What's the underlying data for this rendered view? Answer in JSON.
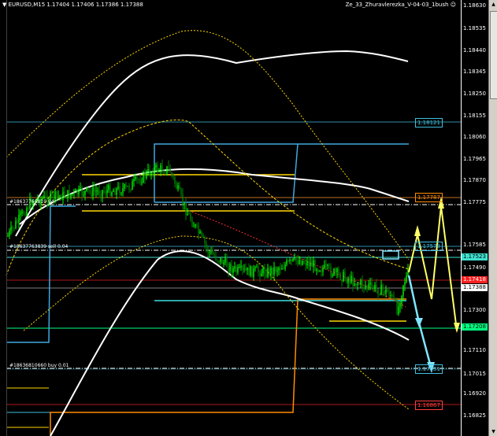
{
  "header": {
    "symbol": "▼ EURUSD,M15  1.17404 1.17406 1.17386 1.17388",
    "indicator": "Ze_33_Zhuravlerezka_V-04-03_1bush"
  },
  "colors": {
    "background": "#000000",
    "candle_up": "#00ff00",
    "candle_down": "#008000",
    "ma_fast": "#ffffff",
    "ma_slow": "#ffd700",
    "level_cyan": "#40c0e0",
    "level_orange": "#ff8c00",
    "level_red": "#ff2020",
    "arrow_yellow": "#ffff66",
    "arrow_cyan": "#7fe6ff"
  },
  "price_axis": {
    "labels": [
      "1.18630",
      "1.18535",
      "1.18440",
      "1.18345",
      "1.18250",
      "1.18155",
      "1.18060",
      "1.17965",
      "1.17870",
      "1.17775",
      "1.17585",
      "1.17490",
      "1.17300",
      "1.17110",
      "1.17015",
      "1.16920",
      "1.16825"
    ],
    "tags": [
      {
        "text": "1.17523",
        "bg": "#40e0d0",
        "fg": "#000000"
      },
      {
        "text": "1.17418",
        "bg": "#ff2020",
        "fg": "#ffffff"
      },
      {
        "text": "1.17388",
        "bg": "#ffffff",
        "fg": "#000000"
      },
      {
        "text": "1.17208",
        "bg": "#00ff80",
        "fg": "#000000"
      }
    ]
  },
  "level_tags": [
    {
      "text": "1.18121",
      "color": "#40c0e0"
    },
    {
      "text": "1.17787",
      "color": "#ff8c00"
    },
    {
      "text": "1.17578",
      "color": "#40c0e0"
    },
    {
      "text": "1.17031",
      "color": "#40c0e0"
    },
    {
      "text": "1.16867",
      "color": "#ff4040"
    }
  ],
  "annotations": {
    "a1": "#18637765810 94",
    "a2": "#18637763839 sell 0.04",
    "a3": "#18636810660 buy 0.01"
  },
  "scrollbar": {
    "up_glyph": "▲",
    "down_glyph": "▼"
  }
}
